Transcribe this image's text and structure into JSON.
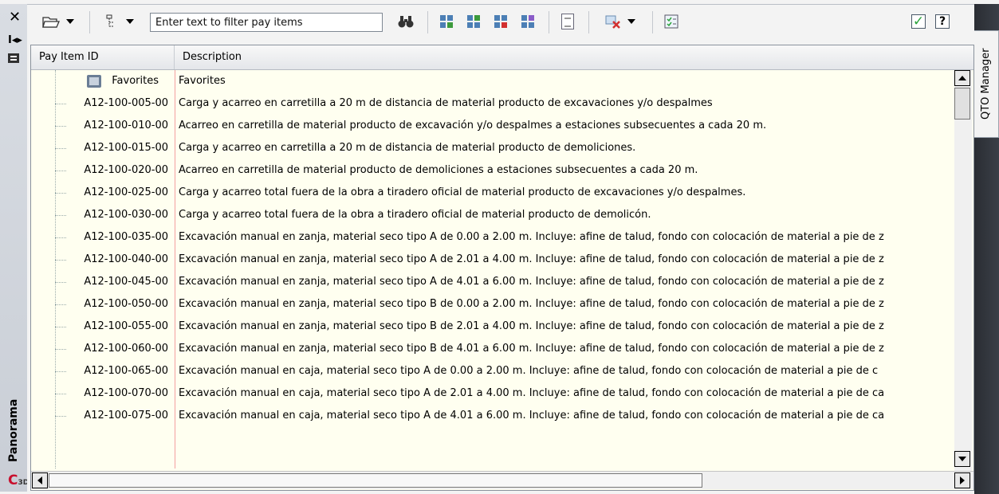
{
  "palette": {
    "frame_dark": "#2a2d33",
    "grid_bg": "#fffff0",
    "column_divider": "#f4a0a0",
    "accent_check": "#2aa23a",
    "logo_red": "#c8102e"
  },
  "left_bar": {
    "title": "Panorama",
    "logo_letter": "C",
    "logo_sub": "3D"
  },
  "right_bar": {
    "tab_label": "QTO Manager"
  },
  "toolbar": {
    "filter_placeholder": "Enter text to filter pay items",
    "icons": [
      "folder-open-icon",
      "filter-tree-icon",
      "binoculars-icon",
      "add-pay-item-icon",
      "edit-pay-item-icon",
      "remove-pay-item-icon",
      "assign-pay-item-icon",
      "report-icon",
      "clear-highlight-icon",
      "pay-item-list-icon",
      "apply-check-icon",
      "help-icon"
    ]
  },
  "grid": {
    "columns": {
      "id": "Pay Item ID",
      "description": "Description"
    },
    "rows": [
      {
        "id": "Favorites",
        "desc": "Favorites"
      },
      {
        "id": "A12-100-005-00",
        "desc": "Carga y acarreo en carretilla a 20 m de distancia de material producto de excavaciones y/o despalmes"
      },
      {
        "id": "A12-100-010-00",
        "desc": "Acarreo en carretilla de material producto de excavación y/o despalmes a estaciones subsecuentes a cada 20 m."
      },
      {
        "id": "A12-100-015-00",
        "desc": "Carga y acarreo en carretilla a 20 m de distancia de material producto de demoliciones."
      },
      {
        "id": "A12-100-020-00",
        "desc": "Acarreo en carretilla de material producto de demoliciones a estaciones subsecuentes a cada 20 m."
      },
      {
        "id": "A12-100-025-00",
        "desc": "Carga y acarreo total fuera de la obra a tiradero oficial de material producto de excavaciones y/o despalmes."
      },
      {
        "id": "A12-100-030-00",
        "desc": "Carga y acarreo total fuera de la obra a tiradero oficial de material producto de demolicón."
      },
      {
        "id": "A12-100-035-00",
        "desc": "Excavación manual en zanja, material seco tipo A de 0.00 a 2.00 m. Incluye: afine de talud, fondo con colocación de material a pie de z"
      },
      {
        "id": "A12-100-040-00",
        "desc": "Excavación manual en zanja, material seco tipo A de 2.01 a 4.00 m. Incluye: afine de talud, fondo con colocación de material a pie de z"
      },
      {
        "id": "A12-100-045-00",
        "desc": "Excavación manual en zanja, material seco tipo A de 4.01 a 6.00 m. Incluye: afine de talud, fondo con colocación de material a pie de z"
      },
      {
        "id": "A12-100-050-00",
        "desc": "Excavación manual en zanja, material seco tipo B de 0.00 a 2.00 m. Incluye: afine de talud, fondo con colocación de material a pie de z"
      },
      {
        "id": "A12-100-055-00",
        "desc": "Excavación manual en zanja, material seco tipo B de 2.01 a 4.00 m. Incluye: afine de talud, fondo con colocación de material a pie de z"
      },
      {
        "id": "A12-100-060-00",
        "desc": "Excavación manual en zanja, material seco tipo B de 4.01 a 6.00 m. Incluye: afine de talud, fondo con colocación de material a pie de z"
      },
      {
        "id": "A12-100-065-00",
        "desc": "Excavación manual en caja, material  seco tipo A de 0.00 a 2.00 m. Incluye: afine de talud, fondo con colocación de material a pie de c"
      },
      {
        "id": "A12-100-070-00",
        "desc": "Excavación manual en caja, material seco tipo A de 2.01 a 4.00 m. Incluye: afine de talud, fondo con colocación de material a pie de ca"
      },
      {
        "id": "A12-100-075-00",
        "desc": "Excavación manual en caja, material seco tipo A de 4.01 a 6.00 m. Incluye: afine de talud, fondo con colocación de material a pie de ca"
      }
    ]
  }
}
